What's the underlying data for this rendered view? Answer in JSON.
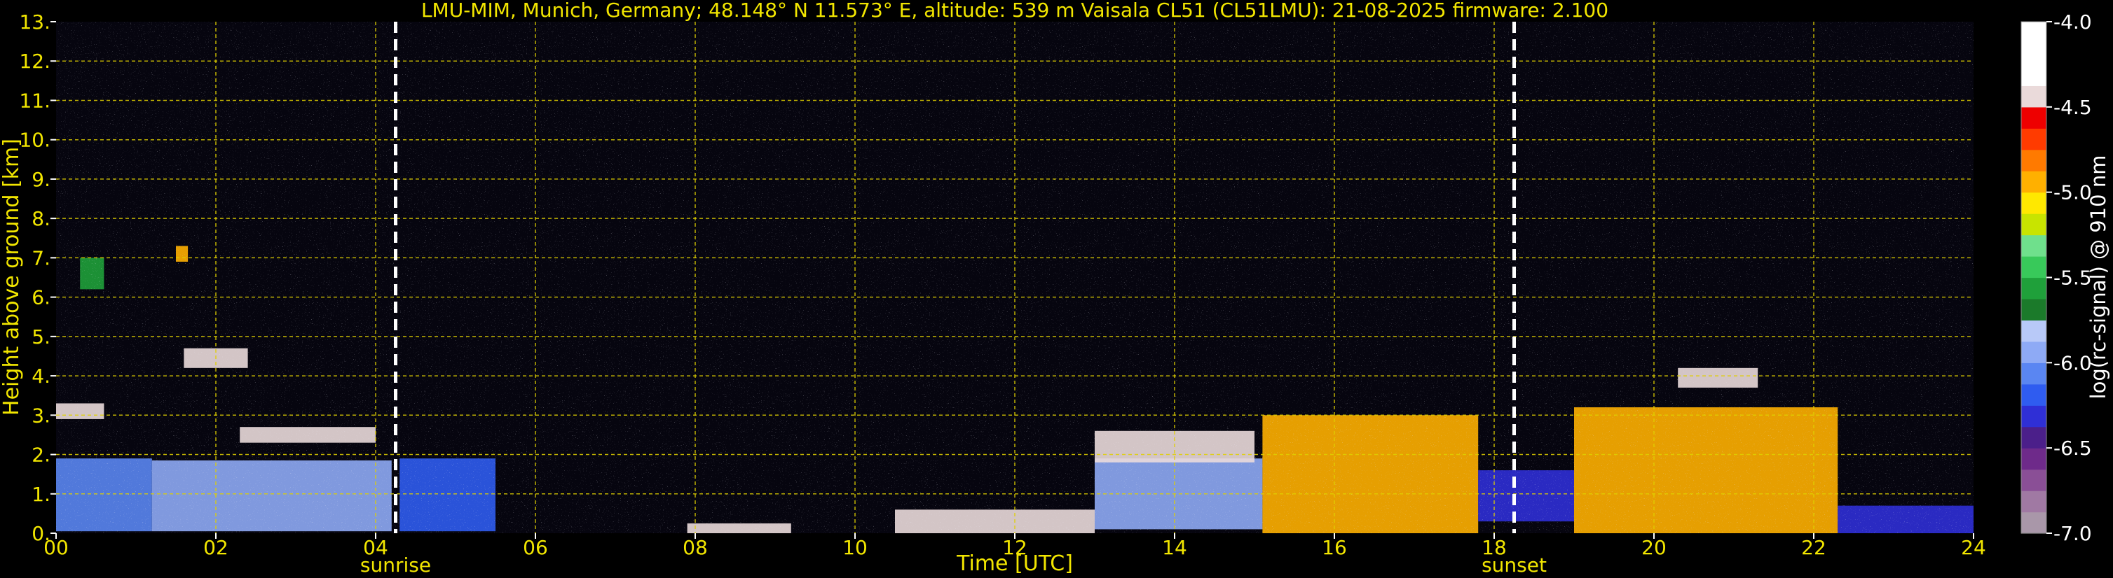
{
  "chart_data": {
    "type": "heatmap",
    "title": "LMU-MIM, Munich, Germany; 48.148° N 11.573° E, altitude: 539 m    Vaisala CL51 (CL51LMU): 21-08-2025    firmware: 2.100",
    "xlabel": "Time [UTC]",
    "ylabel": "Height above ground [km]",
    "xlim": [
      0,
      24
    ],
    "ylim": [
      0,
      13
    ],
    "x_ticks": [
      "00",
      "02",
      "04",
      "06",
      "08",
      "10",
      "12",
      "14",
      "16",
      "18",
      "20",
      "22",
      "24"
    ],
    "y_ticks": [
      "0.",
      "1.",
      "2.",
      "3.",
      "4.",
      "5.",
      "6.",
      "7.",
      "8.",
      "9.",
      "10.",
      "11.",
      "12.",
      "13."
    ],
    "grid": true,
    "markers": [
      {
        "label": "sunrise",
        "x": 4.25
      },
      {
        "label": "sunset",
        "x": 18.25
      }
    ],
    "colorbar": {
      "label": "log(rc-signal) @ 910 nm",
      "ticks": [
        "-4.0",
        "-4.5",
        "-5.0",
        "-5.5",
        "-6.0",
        "-6.5",
        "-7.0"
      ],
      "range": [
        -7.0,
        -4.0
      ],
      "colors": [
        "#a997a9",
        "#a079a3",
        "#8a4f96",
        "#6e2a8a",
        "#4b1f8a",
        "#2f2fd6",
        "#2f5cf0",
        "#5a86f2",
        "#8eaaf5",
        "#b8c9f8",
        "#1b7a2a",
        "#1fa03a",
        "#38c95a",
        "#6fe08c",
        "#c8e400",
        "#ffe800",
        "#ffb000",
        "#ff7a00",
        "#ff3b00",
        "#ee0000",
        "#eadada",
        "#ffffff",
        "#ffffff",
        "#ffffff"
      ]
    },
    "layers": [
      {
        "x": [
          0.0,
          1.2
        ],
        "y": [
          0.05,
          1.9
        ],
        "value": -6.1
      },
      {
        "x": [
          1.2,
          4.2
        ],
        "y": [
          0.05,
          1.85
        ],
        "value": -6.0
      },
      {
        "x": [
          4.3,
          5.5
        ],
        "y": [
          0.05,
          1.9
        ],
        "value": -6.2
      },
      {
        "x": [
          7.9,
          9.2
        ],
        "y": [
          0.0,
          0.25
        ],
        "value": -4.5
      },
      {
        "x": [
          10.5,
          13.0
        ],
        "y": [
          0.0,
          0.6
        ],
        "value": -4.5
      },
      {
        "x": [
          13.0,
          15.1
        ],
        "y": [
          0.1,
          1.9
        ],
        "value": -6.0
      },
      {
        "x": [
          15.1,
          17.8
        ],
        "y": [
          0.0,
          3.0
        ],
        "value": -5.0
      },
      {
        "x": [
          17.8,
          19.0
        ],
        "y": [
          0.3,
          1.6
        ],
        "value": -6.3
      },
      {
        "x": [
          19.0,
          22.3
        ],
        "y": [
          0.0,
          3.2
        ],
        "value": -4.9
      },
      {
        "x": [
          22.3,
          24.0
        ],
        "y": [
          0.0,
          0.7
        ],
        "value": -6.3
      }
    ],
    "cloud_layers": [
      {
        "x": [
          0.0,
          0.6
        ],
        "y": [
          2.9,
          3.3
        ],
        "value": -4.5
      },
      {
        "x": [
          1.6,
          2.4
        ],
        "y": [
          4.2,
          4.7
        ],
        "value": -4.5
      },
      {
        "x": [
          2.3,
          4.0
        ],
        "y": [
          2.3,
          2.7
        ],
        "value": -4.5
      },
      {
        "x": [
          0.3,
          0.6
        ],
        "y": [
          6.2,
          7.0
        ],
        "value": -5.6
      },
      {
        "x": [
          1.5,
          1.65
        ],
        "y": [
          6.9,
          7.3
        ],
        "value": -5.0
      },
      {
        "x": [
          13.0,
          15.0
        ],
        "y": [
          1.8,
          2.6
        ],
        "value": -4.5
      },
      {
        "x": [
          20.3,
          21.3
        ],
        "y": [
          3.7,
          4.2
        ],
        "value": -4.5
      }
    ]
  }
}
